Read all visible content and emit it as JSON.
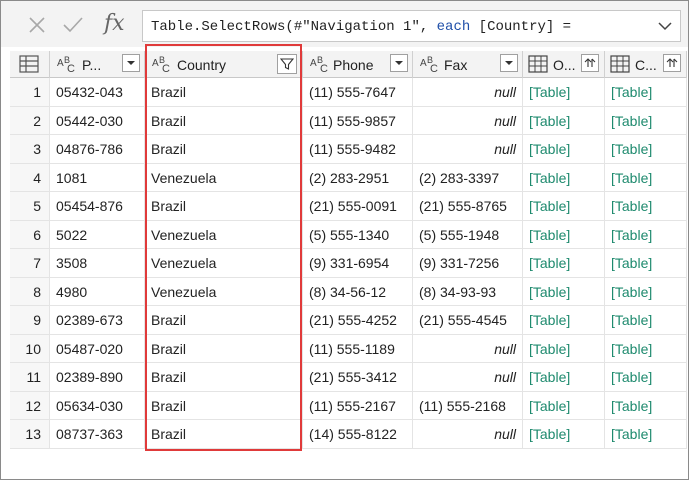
{
  "formula": {
    "prefix": "Table.SelectRows(#\"Navigation 1\", ",
    "keyword": "each",
    "suffix": " [Country] ="
  },
  "columns": [
    {
      "label": "P...",
      "type": "ABC"
    },
    {
      "label": "Country",
      "type": "ABC",
      "filtered": true
    },
    {
      "label": "Phone",
      "type": "ABC"
    },
    {
      "label": "Fax",
      "type": "ABC"
    },
    {
      "label": "O...",
      "type": "table"
    },
    {
      "label": "C...",
      "type": "table"
    }
  ],
  "rows": [
    {
      "n": "1",
      "postal": "05432-043",
      "country": "Brazil",
      "phone": "(11) 555-7647",
      "fax": "null",
      "o": "[Table]",
      "c": "[Table]"
    },
    {
      "n": "2",
      "postal": "05442-030",
      "country": "Brazil",
      "phone": "(11) 555-9857",
      "fax": "null",
      "o": "[Table]",
      "c": "[Table]"
    },
    {
      "n": "3",
      "postal": "04876-786",
      "country": "Brazil",
      "phone": "(11) 555-9482",
      "fax": "null",
      "o": "[Table]",
      "c": "[Table]"
    },
    {
      "n": "4",
      "postal": "1081",
      "country": "Venezuela",
      "phone": "(2) 283-2951",
      "fax": "(2) 283-3397",
      "o": "[Table]",
      "c": "[Table]"
    },
    {
      "n": "5",
      "postal": "05454-876",
      "country": "Brazil",
      "phone": "(21) 555-0091",
      "fax": "(21) 555-8765",
      "o": "[Table]",
      "c": "[Table]"
    },
    {
      "n": "6",
      "postal": "5022",
      "country": "Venezuela",
      "phone": "(5) 555-1340",
      "fax": "(5) 555-1948",
      "o": "[Table]",
      "c": "[Table]"
    },
    {
      "n": "7",
      "postal": "3508",
      "country": "Venezuela",
      "phone": "(9) 331-6954",
      "fax": "(9) 331-7256",
      "o": "[Table]",
      "c": "[Table]"
    },
    {
      "n": "8",
      "postal": "4980",
      "country": "Venezuela",
      "phone": "(8) 34-56-12",
      "fax": "(8) 34-93-93",
      "o": "[Table]",
      "c": "[Table]"
    },
    {
      "n": "9",
      "postal": "02389-673",
      "country": "Brazil",
      "phone": "(21) 555-4252",
      "fax": "(21) 555-4545",
      "o": "[Table]",
      "c": "[Table]"
    },
    {
      "n": "10",
      "postal": "05487-020",
      "country": "Brazil",
      "phone": "(11) 555-1189",
      "fax": "null",
      "o": "[Table]",
      "c": "[Table]"
    },
    {
      "n": "11",
      "postal": "02389-890",
      "country": "Brazil",
      "phone": "(21) 555-3412",
      "fax": "null",
      "o": "[Table]",
      "c": "[Table]"
    },
    {
      "n": "12",
      "postal": "05634-030",
      "country": "Brazil",
      "phone": "(11) 555-2167",
      "fax": "(11) 555-2168",
      "o": "[Table]",
      "c": "[Table]"
    },
    {
      "n": "13",
      "postal": "08737-363",
      "country": "Brazil",
      "phone": "(14) 555-8122",
      "fax": "null",
      "o": "[Table]",
      "c": "[Table]"
    }
  ],
  "colors": {
    "highlight": "#e03a3a",
    "table_link": "#1e8a6e",
    "keyword": "#1f4fa8"
  },
  "icons": [
    "close-icon",
    "check-icon",
    "fx-icon",
    "chevron-down-icon",
    "table-menu-icon",
    "text-type-icon",
    "filter-icon",
    "dropdown-icon",
    "table-type-icon",
    "expand-icon"
  ]
}
